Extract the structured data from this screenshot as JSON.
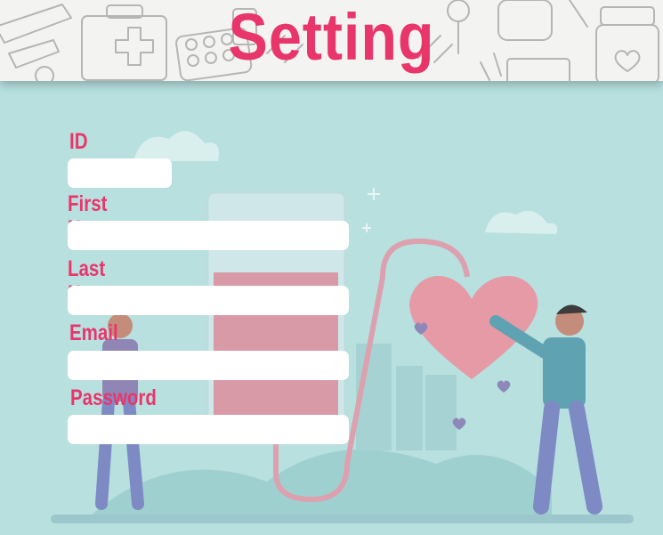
{
  "header": {
    "title": "Setting",
    "title_color": "#e8366b",
    "background_pattern": "medical-doodles"
  },
  "form": {
    "fields": [
      {
        "key": "id",
        "label": "ID",
        "value": ""
      },
      {
        "key": "first_name",
        "label": "First Name",
        "value": ""
      },
      {
        "key": "last_name",
        "label": "Last Name",
        "value": ""
      },
      {
        "key": "email",
        "label": "Email",
        "value": ""
      },
      {
        "key": "password",
        "label": "Password",
        "value": ""
      }
    ]
  },
  "background": {
    "color": "#b7e0df",
    "illustration": "blood-donation"
  }
}
